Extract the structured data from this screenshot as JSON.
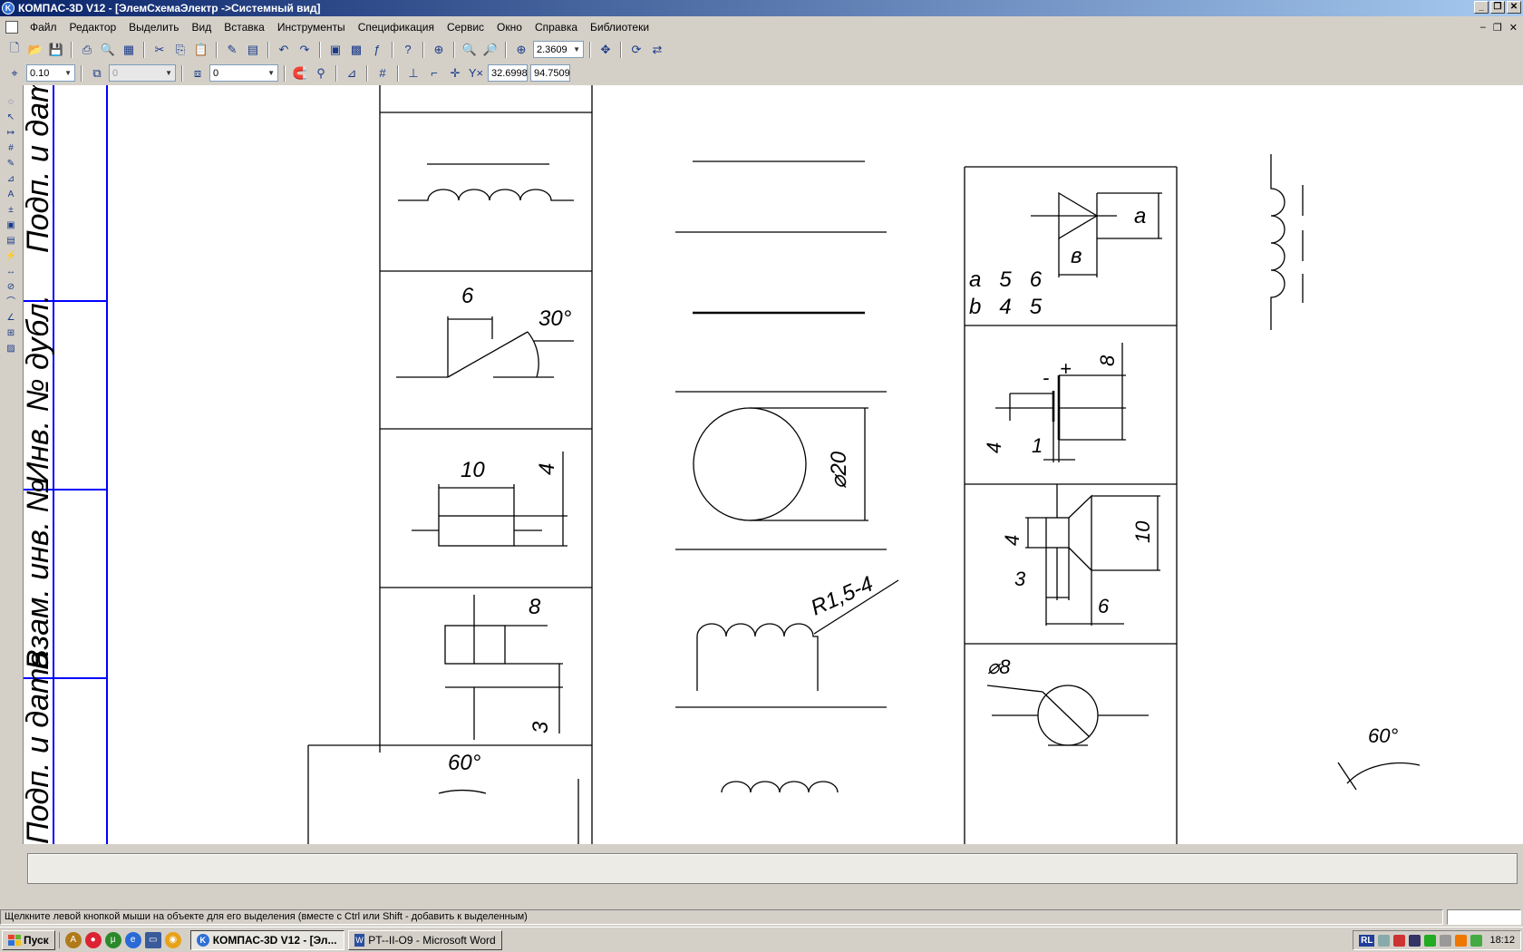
{
  "window": {
    "title": "КОМПАС-3D V12 - [ЭлемСхемаЭлектр ->Системный вид]",
    "icon": "kompas-logo-icon"
  },
  "menu": [
    "Файл",
    "Редактор",
    "Выделить",
    "Вид",
    "Вставка",
    "Инструменты",
    "Спецификация",
    "Сервис",
    "Окно",
    "Справка",
    "Библиотеки"
  ],
  "toolbar1": {
    "zoom_value": "2.3609"
  },
  "toolbar2": {
    "step_value": "0.10",
    "layer_value": "0",
    "style_value": "0",
    "coord_x": "32.6998",
    "coord_y": "94.7509",
    "coord_label": "Y×"
  },
  "drawing": {
    "stamp_labels": [
      "Подп. и дата",
      "Инв. № дубл.",
      "Взам. инв. №",
      "Подп. и дата"
    ],
    "dims": {
      "d6": "6",
      "a30": "30°",
      "d10": "10",
      "d4a": "4",
      "d8": "8",
      "d3": "3",
      "a60": "60°",
      "phi20": "⌀20",
      "r15": "R1,5-4",
      "tbl_a": "a",
      "tbl_b": "в",
      "row1": "a   5   6",
      "row2": "b   4   5",
      "cap_minus": "-",
      "cap_plus": "+",
      "cap_8": "8",
      "cap_4": "4",
      "cap_1": "1",
      "spk_4": "4",
      "spk_10": "10",
      "spk_3": "3",
      "spk_6": "6",
      "phi8": "⌀8",
      "a60b": "60°"
    }
  },
  "status": {
    "text": "Щелкните левой кнопкой мыши на объекте для его выделения (вместе с Ctrl или Shift - добавить к выделенным)"
  },
  "taskbar": {
    "start_label": "Пуск",
    "tasks": [
      {
        "label": "КОМПАС-3D V12 - [Эл...",
        "active": true
      },
      {
        "label": "PT--II-O9 - Microsoft Word",
        "active": false
      }
    ],
    "lang": "RL",
    "clock": "18:12"
  }
}
